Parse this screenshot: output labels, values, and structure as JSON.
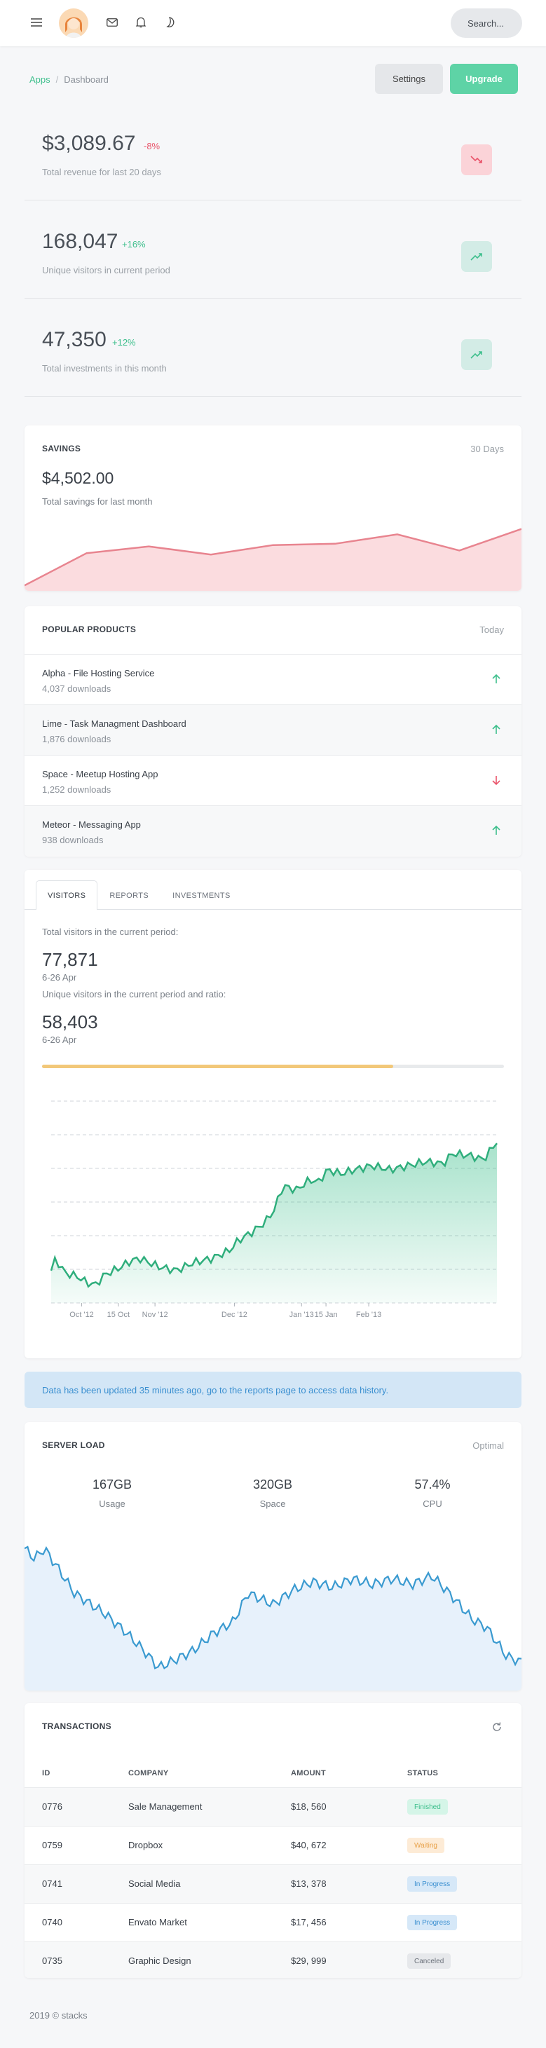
{
  "header": {
    "search_placeholder": "Search...",
    "icons": [
      "menu-icon",
      "mail-icon",
      "bell-icon",
      "moon-icon"
    ]
  },
  "breadcrumb": {
    "apps": "Apps",
    "separator": "/",
    "current": "Dashboard"
  },
  "actions": {
    "settings": "Settings",
    "upgrade": "Upgrade"
  },
  "stats": [
    {
      "value": "$3,089.67",
      "change": "-8%",
      "label": "Total revenue for last 20 days",
      "trend": "down",
      "color": "#e9546b"
    },
    {
      "value": "168,047",
      "change": "+16%",
      "label": "Unique visitors in current period",
      "trend": "up",
      "color": "#3dbf8c"
    },
    {
      "value": "47,350",
      "change": "+12%",
      "label": "Total investments in this month",
      "trend": "up",
      "color": "#3dbf8c"
    }
  ],
  "savings": {
    "title": "SAVINGS",
    "period": "30 Days",
    "amount": "$4,502.00",
    "caption": "Total savings for last month",
    "sparkline": [
      4,
      28,
      33,
      27,
      34,
      35,
      42,
      30,
      46
    ]
  },
  "popular": {
    "title": "POPULAR PRODUCTS",
    "period": "Today",
    "items": [
      {
        "name": "Alpha - File Hosting Service",
        "downloads": "4,037 downloads",
        "trend": "up"
      },
      {
        "name": "Lime - Task Managment Dashboard",
        "downloads": "1,876 downloads",
        "trend": "up"
      },
      {
        "name": "Space - Meetup Hosting App",
        "downloads": "1,252 downloads",
        "trend": "down"
      },
      {
        "name": "Meteor - Messaging App",
        "downloads": "938 downloads",
        "trend": "up"
      }
    ]
  },
  "visitors": {
    "tabs": [
      "VISITORS",
      "REPORTS",
      "INVESTMENTS"
    ],
    "total_label": "Total visitors in the current period:",
    "total_value": "77,871",
    "total_range": "6-26 Apr",
    "unique_label": "Unique visitors in the current period and ratio:",
    "unique_value": "58,403",
    "unique_range": "6-26 Apr",
    "ratio": 0.76,
    "x_ticks": [
      "Oct '12",
      "15 Oct",
      "Nov '12",
      "Dec '12",
      "Jan '13",
      "15 Jan",
      "Feb '13"
    ]
  },
  "alert": {
    "text": "Data has been updated 35 minutes ago, go to the reports page to access data history."
  },
  "server": {
    "title": "SERVER LOAD",
    "status": "Optimal",
    "metrics": [
      {
        "value": "167GB",
        "label": "Usage"
      },
      {
        "value": "320GB",
        "label": "Space"
      },
      {
        "value": "57.4%",
        "label": "CPU"
      }
    ]
  },
  "transactions": {
    "title": "TRANSACTIONS",
    "columns": [
      "ID",
      "COMPANY",
      "AMOUNT",
      "STATUS"
    ],
    "rows": [
      {
        "id": "0776",
        "company": "Sale Management",
        "amount": "$18, 560",
        "status": "Finished",
        "bg": "#d5f5e8",
        "fg": "#3dbf8c"
      },
      {
        "id": "0759",
        "company": "Dropbox",
        "amount": "$40, 672",
        "status": "Waiting",
        "bg": "#fdebd6",
        "fg": "#e8a24a"
      },
      {
        "id": "0741",
        "company": "Social Media",
        "amount": "$13, 378",
        "status": "In Progress",
        "bg": "#d6e8f8",
        "fg": "#3a8fd0"
      },
      {
        "id": "0740",
        "company": "Envato Market",
        "amount": "$17, 456",
        "status": "In Progress",
        "bg": "#d6e8f8",
        "fg": "#3a8fd0"
      },
      {
        "id": "0735",
        "company": "Graphic Design",
        "amount": "$29, 999",
        "status": "Canceled",
        "bg": "#e6e8eb",
        "fg": "#6b717a"
      }
    ]
  },
  "footer": {
    "text": "2019 © stacks"
  }
}
